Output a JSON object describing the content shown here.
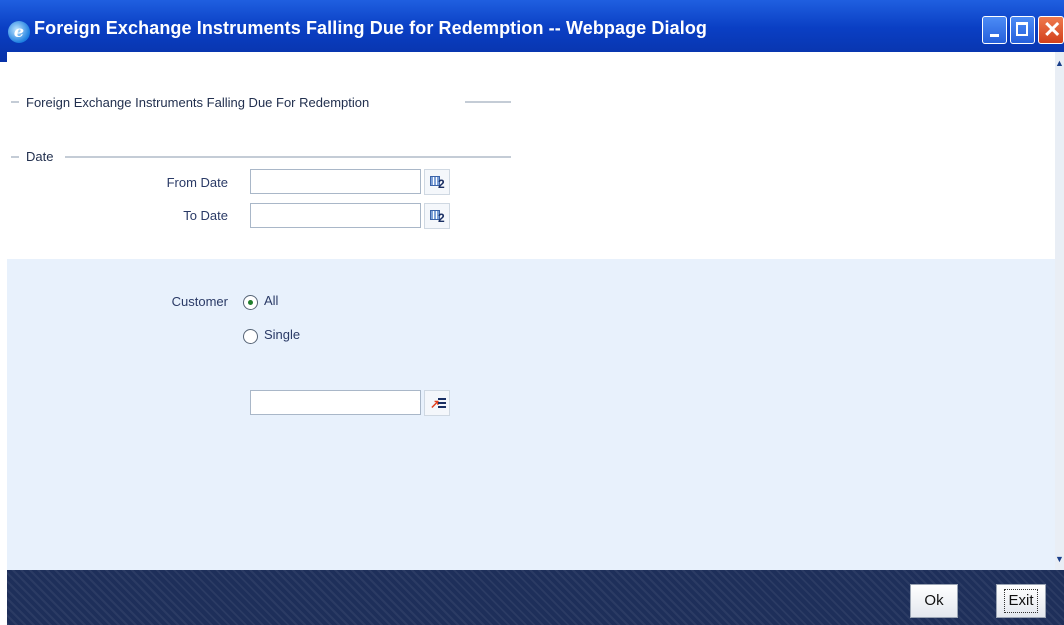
{
  "window": {
    "title": "Foreign Exchange Instruments Falling Due for Redemption -- Webpage Dialog",
    "app_icon": "ie-icon",
    "controls": [
      "minimize-icon",
      "maximize-icon",
      "close-icon"
    ],
    "colors": {
      "title_bar": "#0a3fc4",
      "footer": "#1e2f5a",
      "lower_panel": "#e8f1fc"
    }
  },
  "form": {
    "heading": "Foreign Exchange Instruments Falling Due For Redemption",
    "date_section": {
      "heading": "Date",
      "from_date": {
        "label": "From Date",
        "value": "",
        "button_icon": "calendar-icon",
        "button_text": "2"
      },
      "to_date": {
        "label": "To Date",
        "value": "",
        "button_icon": "calendar-icon",
        "button_text": "2"
      }
    },
    "customer": {
      "label": "Customer",
      "options": [
        {
          "label": "All",
          "selected": true
        },
        {
          "label": "Single",
          "selected": false
        }
      ],
      "customer_value": "",
      "lov_icon": "list-of-values-icon"
    }
  },
  "footer": {
    "ok_label": "Ok",
    "exit_label": "Exit"
  }
}
